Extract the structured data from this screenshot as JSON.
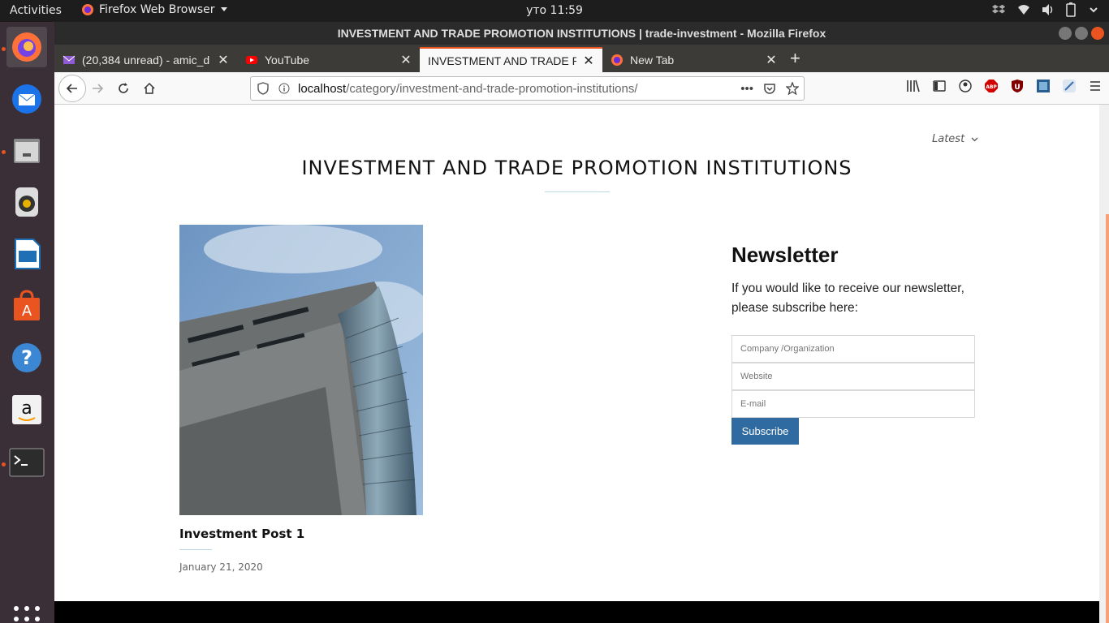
{
  "system": {
    "activities": "Activities",
    "app_menu": "Firefox Web Browser",
    "clock": "уто 11:59"
  },
  "dock": {
    "items": [
      "firefox-icon",
      "thunderbird-icon",
      "files-icon",
      "rhythmbox-icon",
      "libreoffice-writer-icon",
      "software-center-icon",
      "help-icon",
      "amazon-icon",
      "terminal-icon"
    ]
  },
  "browser": {
    "window_title": "INVESTMENT AND TRADE PROMOTION INSTITUTIONS | trade-investment - Mozilla Firefox",
    "tabs": [
      {
        "label": "(20,384 unread) - amic_d"
      },
      {
        "label": "YouTube"
      },
      {
        "label": "INVESTMENT AND TRADE P"
      },
      {
        "label": "New Tab"
      }
    ],
    "url_host": "localhost",
    "url_path": "/category/investment-and-trade-promotion-institutions/"
  },
  "page": {
    "sort_label": "Latest",
    "title": "INVESTMENT AND TRADE PROMOTION INSTITUTIONS",
    "post": {
      "title": "Investment Post 1",
      "date": "January 21, 2020"
    },
    "newsletter": {
      "title": "Newsletter",
      "text": "If you would like to receive our newsletter, please subscribe here:",
      "company_placeholder": "Company /Organization",
      "website_placeholder": "Website",
      "email_placeholder": "E-mail",
      "subscribe_label": "Subscribe"
    }
  },
  "colors": {
    "accent": "#e95420",
    "button": "#2f6ba1",
    "dock_bg": "#3a2f36"
  }
}
